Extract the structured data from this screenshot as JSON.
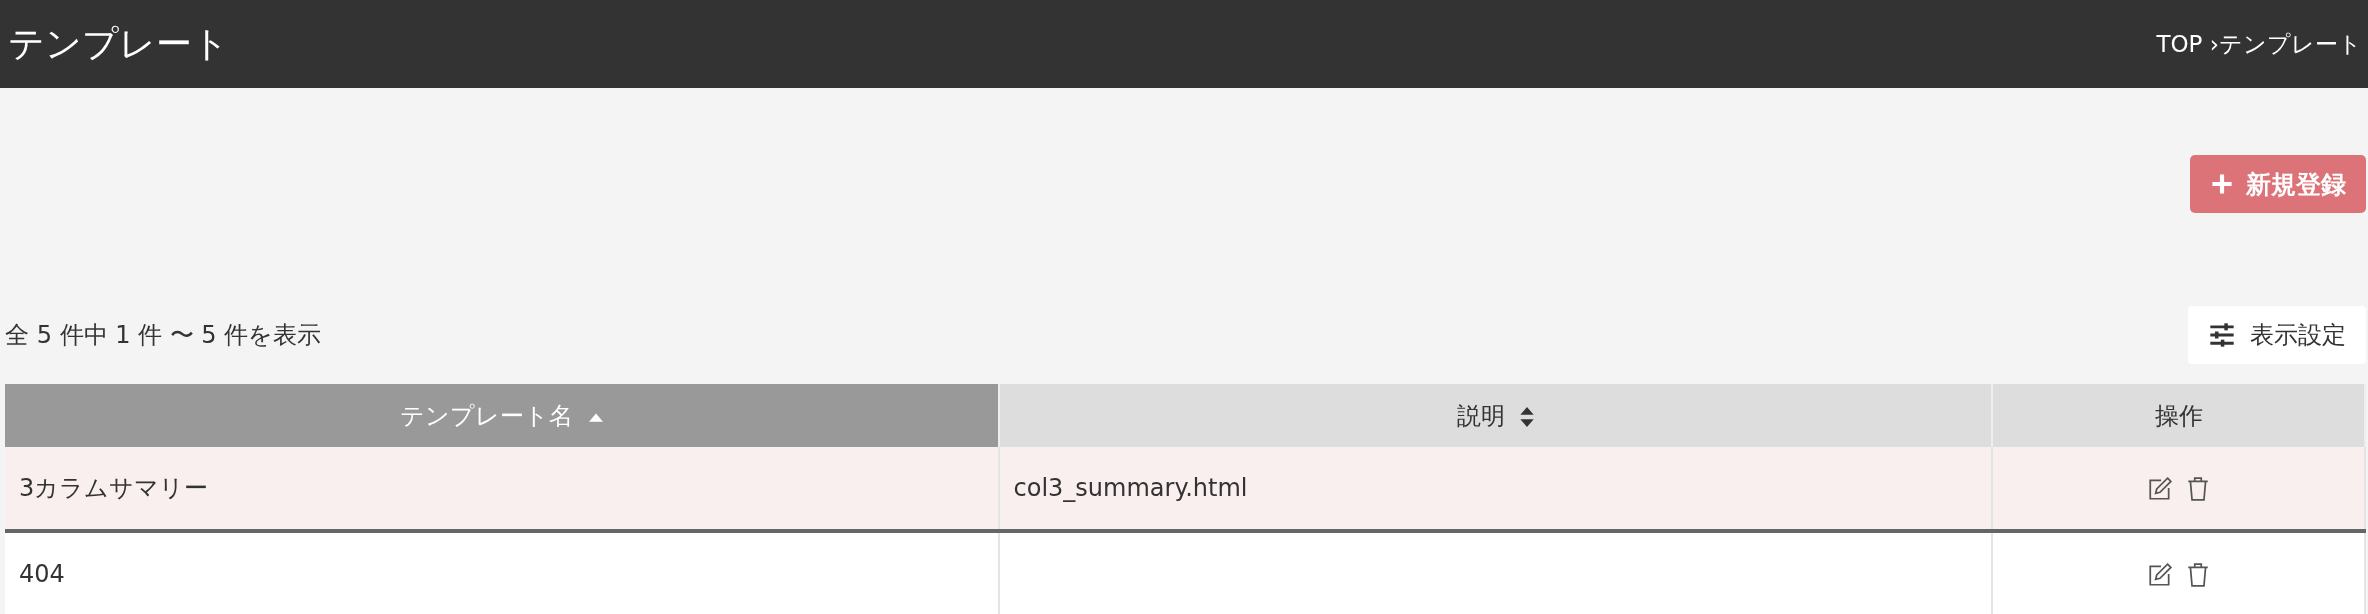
{
  "header": {
    "title": "テンプレート",
    "breadcrumb": "TOP ›テンプレート"
  },
  "new_button": {
    "label": "新規登録"
  },
  "result_count": "全 5 件中 1 件 〜 5 件を表示",
  "display_settings_button": {
    "label": "表示設定"
  },
  "table": {
    "columns": [
      {
        "label": "テンプレート名",
        "sortable": true,
        "sorted": true
      },
      {
        "label": "説明",
        "sortable": true,
        "sorted": false
      },
      {
        "label": "操作",
        "sortable": false,
        "sorted": false
      }
    ],
    "rows": [
      {
        "name": "3カラムサマリー",
        "description": "col3_summary.html",
        "selected": true
      },
      {
        "name": "404",
        "description": "",
        "selected": false
      }
    ]
  }
}
